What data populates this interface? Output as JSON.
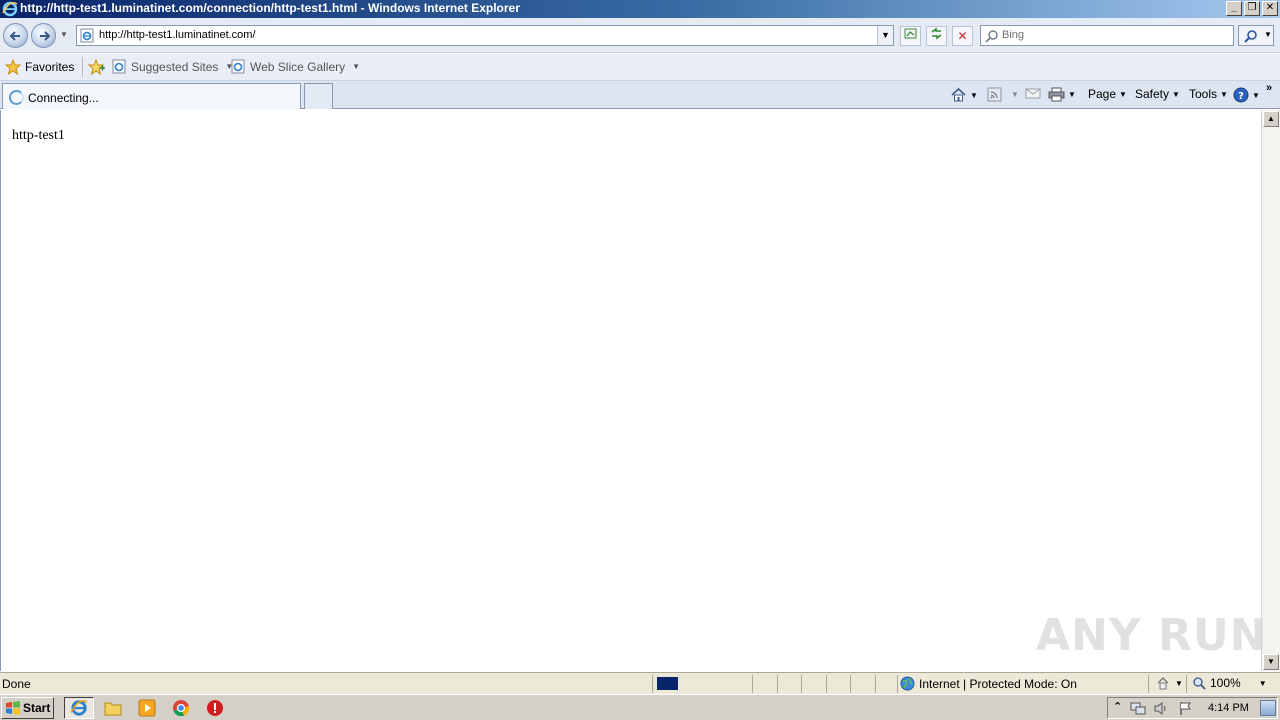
{
  "window": {
    "title": "http://http-test1.luminatinet.com/connection/http-test1.html - Windows Internet Explorer",
    "controls": [
      "_",
      "❐",
      "✕"
    ]
  },
  "address_bar": {
    "url": "http://http-test1.luminatinet.com/"
  },
  "search": {
    "placeholder": "Bing"
  },
  "favorites_bar": {
    "favorites_label": "Favorites",
    "items": [
      {
        "label": "Suggested Sites",
        "icon": "ie-page-icon"
      },
      {
        "label": "Web Slice Gallery",
        "icon": "ie-page-icon"
      }
    ]
  },
  "tab": {
    "label": "Connecting..."
  },
  "command_bar": {
    "items": [
      "Page",
      "Safety",
      "Tools"
    ]
  },
  "page": {
    "text": "http-test1"
  },
  "status_bar": {
    "text": "Done",
    "zone": "Internet | Protected Mode: On",
    "zoom": "100%"
  },
  "taskbar": {
    "start_label": "Start",
    "apps": [
      "internet-explorer",
      "file-explorer",
      "media-player",
      "chrome",
      "stop-app"
    ],
    "clock": "4:14 PM"
  },
  "watermark": {
    "text": "ANY RUN"
  },
  "colors": {
    "title_gradient_start": "#0a246a",
    "title_gradient_end": "#a6caf0",
    "chrome_bg": "#e4ebf5",
    "taskbar_bg": "#d4d0c8"
  }
}
